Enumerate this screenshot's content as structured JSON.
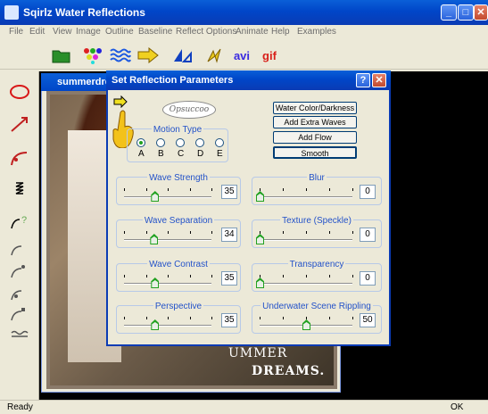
{
  "app": {
    "title": "Sqirlz Water Reflections"
  },
  "menu": [
    "File",
    "Edit",
    "View",
    "Image",
    "Outline",
    "Baseline",
    "Reflect Options",
    "Animate",
    "Help",
    "Examples"
  ],
  "toolbar": {
    "avi_label": "avi",
    "gif_label": "gif"
  },
  "image_window": {
    "title": "summerdre",
    "caption_line1": "UMMER",
    "caption_line2": "DREAMS."
  },
  "status": {
    "left": "Ready",
    "right": "OK"
  },
  "dialog": {
    "title": "Set Reflection Parameters",
    "logo_text": "Opsuccoo",
    "motion_type": {
      "label": "Motion Type",
      "options": [
        "A",
        "B",
        "C",
        "D",
        "E"
      ],
      "selected": "A"
    },
    "buttons": [
      "Water Color/Darkness",
      "Add Extra Waves",
      "Add Flow",
      "Smooth"
    ],
    "sliders": [
      {
        "label": "Wave Strength",
        "value": "35",
        "level": 0.35
      },
      {
        "label": "Blur",
        "value": "0",
        "level": 0
      },
      {
        "label": "Wave Separation",
        "value": "34",
        "level": 0.34
      },
      {
        "label": "Texture (Speckle)",
        "value": "0",
        "level": 0
      },
      {
        "label": "Wave Contrast",
        "value": "35",
        "level": 0.35
      },
      {
        "label": "Transparency",
        "value": "0",
        "level": 0
      },
      {
        "label": "Perspective",
        "value": "35",
        "level": 0.35
      },
      {
        "label": "Underwater Scene Rippling",
        "value": "50",
        "level": 0.5
      }
    ]
  },
  "colors": {
    "titlebar": "#0046c8",
    "accent_green": "#21a121",
    "group_label": "#2352c9"
  }
}
